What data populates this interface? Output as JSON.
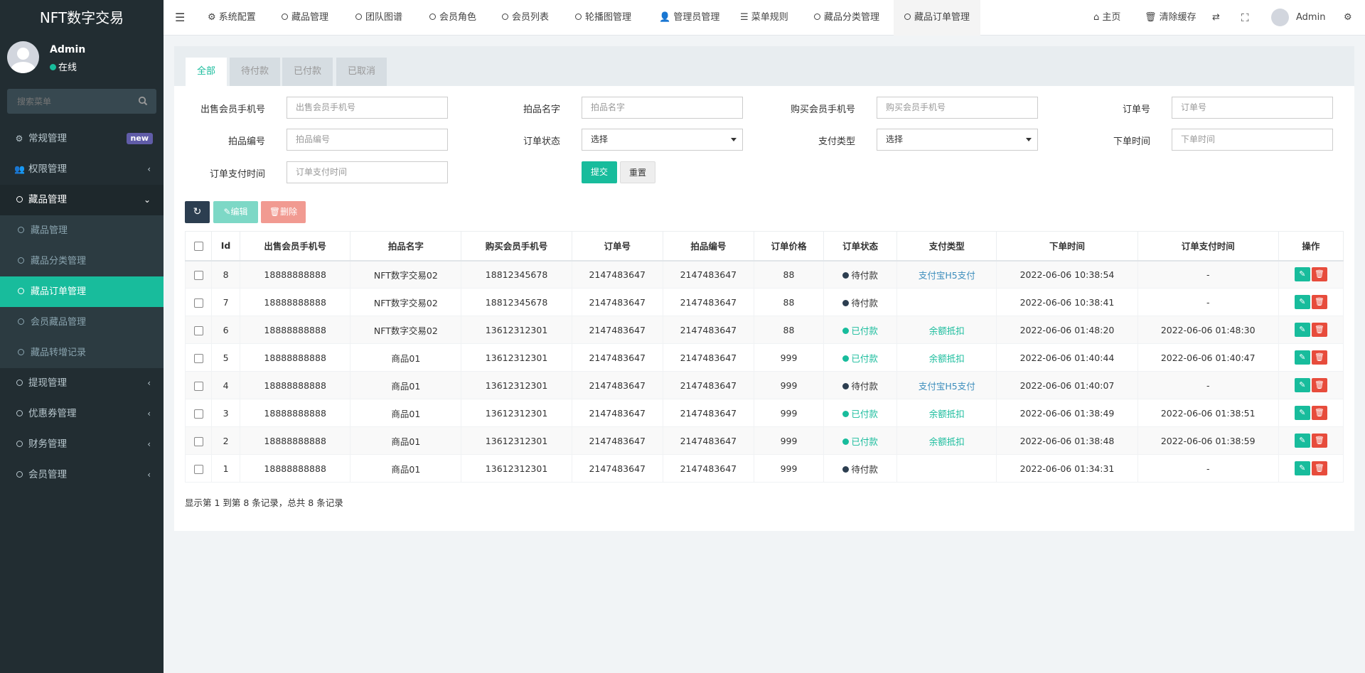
{
  "app_title": "NFT数字交易",
  "user": {
    "name": "Admin",
    "status": "在线"
  },
  "sidebar": {
    "search_placeholder": "搜索菜单",
    "new_badge": "new",
    "items": [
      {
        "label": "常规管理"
      },
      {
        "label": "权限管理"
      },
      {
        "label": "藏品管理"
      },
      {
        "label": "提现管理"
      },
      {
        "label": "优惠券管理"
      },
      {
        "label": "财务管理"
      },
      {
        "label": "会员管理"
      }
    ],
    "sub_items": [
      {
        "label": "藏品管理"
      },
      {
        "label": "藏品分类管理"
      },
      {
        "label": "藏品订单管理"
      },
      {
        "label": "会员藏品管理"
      },
      {
        "label": "藏品转增记录"
      }
    ]
  },
  "topbar": {
    "tabs": [
      "系统配置",
      "藏品管理",
      "团队图谱",
      "会员角色",
      "会员列表",
      "轮播图管理",
      "管理员管理",
      "菜单规则",
      "藏品分类管理",
      "藏品订单管理"
    ],
    "home": "主页",
    "clear_cache": "清除缓存",
    "user": "Admin"
  },
  "content_tabs": [
    "全部",
    "待付款",
    "已付款",
    "已取消"
  ],
  "filters": {
    "seller_phone": {
      "label": "出售会员手机号",
      "placeholder": "出售会员手机号"
    },
    "item_name": {
      "label": "拍品名字",
      "placeholder": "拍品名字"
    },
    "buyer_phone": {
      "label": "购买会员手机号",
      "placeholder": "购买会员手机号"
    },
    "order_no": {
      "label": "订单号",
      "placeholder": "订单号"
    },
    "item_no": {
      "label": "拍品编号",
      "placeholder": "拍品编号"
    },
    "order_status": {
      "label": "订单状态",
      "value": "选择"
    },
    "pay_type": {
      "label": "支付类型",
      "value": "选择"
    },
    "order_time": {
      "label": "下单时间",
      "placeholder": "下单时间"
    },
    "pay_time": {
      "label": "订单支付时间",
      "placeholder": "订单支付时间"
    },
    "submit": "提交",
    "reset": "重置"
  },
  "toolbar": {
    "edit": "编辑",
    "delete": "删除"
  },
  "table": {
    "headers": [
      "Id",
      "出售会员手机号",
      "拍品名字",
      "购买会员手机号",
      "订单号",
      "拍品编号",
      "订单价格",
      "订单状态",
      "支付类型",
      "下单时间",
      "订单支付时间",
      "操作"
    ],
    "rows": [
      {
        "id": "8",
        "seller": "18888888888",
        "name": "NFT数字交易02",
        "buyer": "18812345678",
        "order_no": "2147483647",
        "item_no": "2147483647",
        "price": "88",
        "status": "待付款",
        "paid": false,
        "pay_type": "支付宝H5支付",
        "pay_type_style": "link",
        "order_time": "2022-06-06 10:38:54",
        "pay_time": "-"
      },
      {
        "id": "7",
        "seller": "18888888888",
        "name": "NFT数字交易02",
        "buyer": "18812345678",
        "order_no": "2147483647",
        "item_no": "2147483647",
        "price": "88",
        "status": "待付款",
        "paid": false,
        "pay_type": "",
        "pay_type_style": "none",
        "order_time": "2022-06-06 10:38:41",
        "pay_time": "-"
      },
      {
        "id": "6",
        "seller": "18888888888",
        "name": "NFT数字交易02",
        "buyer": "13612312301",
        "order_no": "2147483647",
        "item_no": "2147483647",
        "price": "88",
        "status": "已付款",
        "paid": true,
        "pay_type": "余额抵扣",
        "pay_type_style": "green",
        "order_time": "2022-06-06 01:48:20",
        "pay_time": "2022-06-06 01:48:30"
      },
      {
        "id": "5",
        "seller": "18888888888",
        "name": "商品01",
        "buyer": "13612312301",
        "order_no": "2147483647",
        "item_no": "2147483647",
        "price": "999",
        "status": "已付款",
        "paid": true,
        "pay_type": "余额抵扣",
        "pay_type_style": "green",
        "order_time": "2022-06-06 01:40:44",
        "pay_time": "2022-06-06 01:40:47"
      },
      {
        "id": "4",
        "seller": "18888888888",
        "name": "商品01",
        "buyer": "13612312301",
        "order_no": "2147483647",
        "item_no": "2147483647",
        "price": "999",
        "status": "待付款",
        "paid": false,
        "pay_type": "支付宝H5支付",
        "pay_type_style": "link",
        "order_time": "2022-06-06 01:40:07",
        "pay_time": "-"
      },
      {
        "id": "3",
        "seller": "18888888888",
        "name": "商品01",
        "buyer": "13612312301",
        "order_no": "2147483647",
        "item_no": "2147483647",
        "price": "999",
        "status": "已付款",
        "paid": true,
        "pay_type": "余额抵扣",
        "pay_type_style": "green",
        "order_time": "2022-06-06 01:38:49",
        "pay_time": "2022-06-06 01:38:51"
      },
      {
        "id": "2",
        "seller": "18888888888",
        "name": "商品01",
        "buyer": "13612312301",
        "order_no": "2147483647",
        "item_no": "2147483647",
        "price": "999",
        "status": "已付款",
        "paid": true,
        "pay_type": "余额抵扣",
        "pay_type_style": "green",
        "order_time": "2022-06-06 01:38:48",
        "pay_time": "2022-06-06 01:38:59"
      },
      {
        "id": "1",
        "seller": "18888888888",
        "name": "商品01",
        "buyer": "13612312301",
        "order_no": "2147483647",
        "item_no": "2147483647",
        "price": "999",
        "status": "待付款",
        "paid": false,
        "pay_type": "",
        "pay_type_style": "none",
        "order_time": "2022-06-06 01:34:31",
        "pay_time": "-"
      }
    ]
  },
  "pagination_text": "显示第 1 到第 8 条记录，总共 8 条记录",
  "colors": {
    "accent": "#18bc9c",
    "sidebar": "#222d32",
    "danger": "#e74c3c",
    "link": "#3c8dbc",
    "unpaid_dot": "#2c3e50"
  }
}
